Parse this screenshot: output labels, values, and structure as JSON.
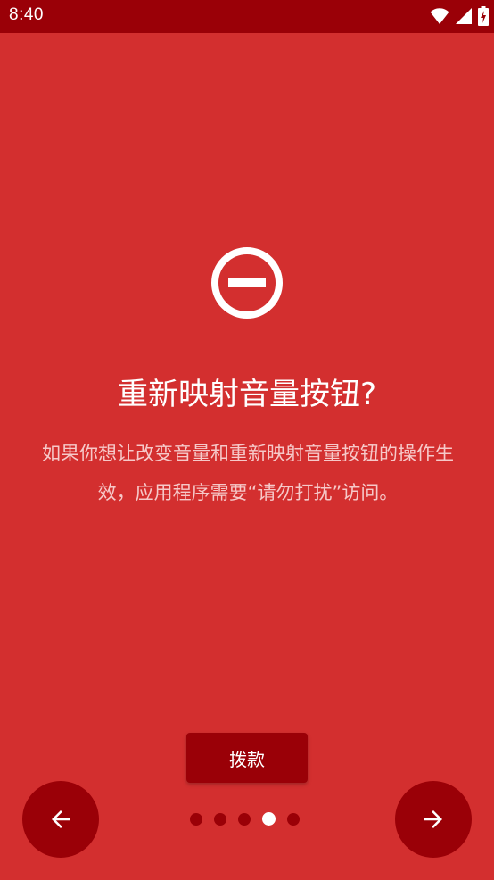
{
  "status_bar": {
    "time": "8:40",
    "icons": [
      "wifi-icon",
      "cellular-signal-icon",
      "battery-charging-icon"
    ]
  },
  "main": {
    "icon": "do-not-disturb-icon",
    "title": "重新映射音量按钮?",
    "description": "如果你想让改变音量和重新映射音量按钮的操作生效，应用程序需要“请勿打扰”访问。"
  },
  "actions": {
    "primary_label": "拨款"
  },
  "navigation": {
    "prev_icon": "arrow-back-icon",
    "next_icon": "arrow-forward-icon",
    "page_count": 5,
    "current_page": 4
  },
  "colors": {
    "background": "#d32f2f",
    "dark": "#9a0007",
    "text": "#ffffff"
  }
}
